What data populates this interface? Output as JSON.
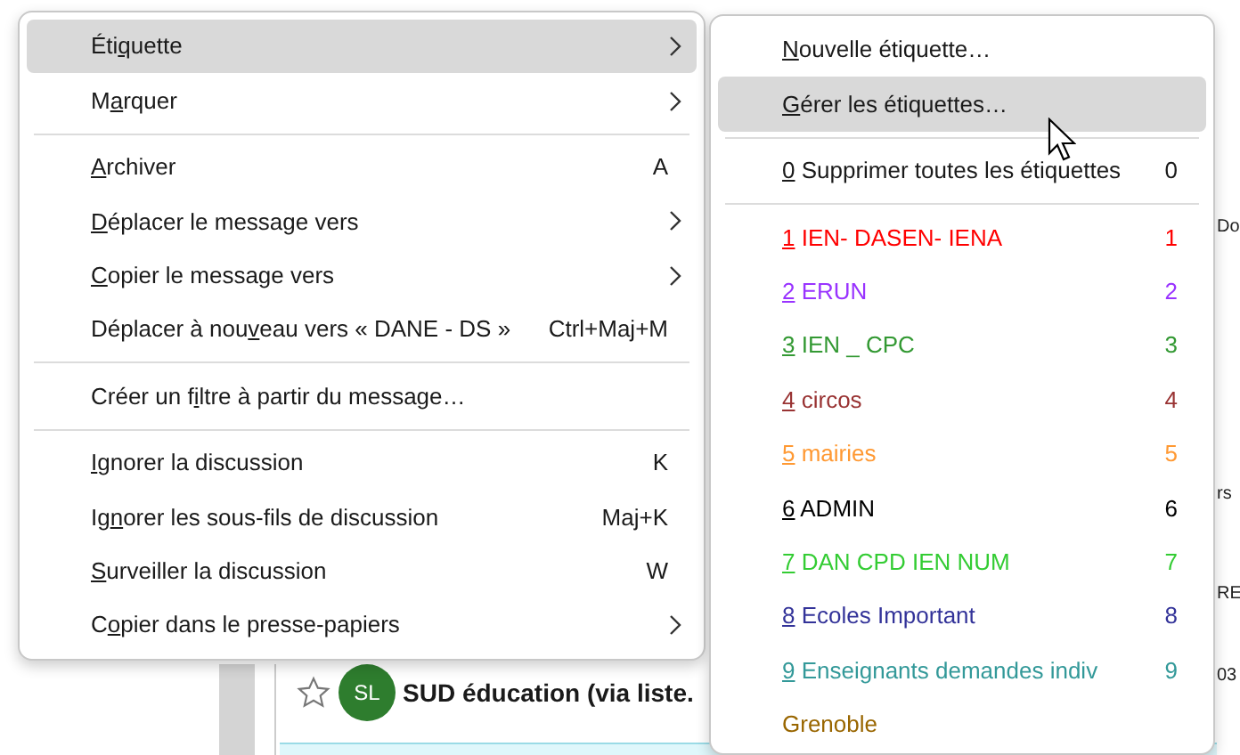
{
  "background": {
    "fragments": [
      "Do",
      "rs",
      "RE",
      "03"
    ],
    "message_row": {
      "starred": false,
      "avatar": "SL",
      "sender": "SUD éducation (via liste."
    }
  },
  "context_menu": {
    "items": [
      {
        "kind": "item",
        "label": {
          "pre": "Éti",
          "key": "q",
          "post": "uette"
        },
        "submenu": true,
        "selected": true
      },
      {
        "kind": "item",
        "label": {
          "pre": "M",
          "key": "a",
          "post": "rquer"
        },
        "submenu": true,
        "selected": false
      },
      {
        "kind": "separator"
      },
      {
        "kind": "item",
        "label": {
          "key": "A",
          "post": "rchiver"
        },
        "shortcut": "A",
        "selected": false
      },
      {
        "kind": "item",
        "label": {
          "key": "D",
          "post": "éplacer le message vers"
        },
        "submenu": true,
        "selected": false
      },
      {
        "kind": "item",
        "label": {
          "key": "C",
          "post": "opier le message vers"
        },
        "submenu": true,
        "selected": false
      },
      {
        "kind": "item",
        "label": {
          "pre": "Déplacer à nou",
          "key": "v",
          "post": "eau vers « DANE - DS »"
        },
        "shortcut": "Ctrl+Maj+M",
        "selected": false
      },
      {
        "kind": "separator"
      },
      {
        "kind": "item",
        "label": {
          "pre": "Créer un f",
          "key": "i",
          "post": "ltre à partir du message…"
        },
        "selected": false
      },
      {
        "kind": "separator"
      },
      {
        "kind": "item",
        "label": {
          "key": "I",
          "post": "gnorer la discussion"
        },
        "shortcut": "K",
        "selected": false
      },
      {
        "kind": "item",
        "label": {
          "pre": "Ig",
          "key": "n",
          "post": "orer les sous-fils de discussion"
        },
        "shortcut": "Maj+K",
        "selected": false
      },
      {
        "kind": "item",
        "label": {
          "key": "S",
          "post": "urveiller la discussion"
        },
        "shortcut": "W",
        "selected": false
      },
      {
        "kind": "item",
        "label": {
          "pre": "C",
          "key": "o",
          "post": "pier dans le presse-papiers"
        },
        "submenu": true,
        "selected": false
      }
    ]
  },
  "tag_submenu": {
    "items": [
      {
        "kind": "item",
        "label": {
          "key": "N",
          "post": "ouvelle étiquette…"
        },
        "selected": false
      },
      {
        "kind": "item",
        "label": {
          "key": "G",
          "post": "érer les étiquettes…"
        },
        "selected": true
      },
      {
        "kind": "separator"
      },
      {
        "kind": "item",
        "label": {
          "key": "0",
          "post": " Supprimer toutes les étiquettes"
        },
        "shortcut": "0",
        "selected": false
      },
      {
        "kind": "separator"
      },
      {
        "kind": "tag",
        "label": {
          "key": "1",
          "post": " IEN- DASEN- IENA"
        },
        "shortcut": "1",
        "color": "#ff0000",
        "selected": false
      },
      {
        "kind": "tag",
        "label": {
          "key": "2",
          "post": " ERUN"
        },
        "shortcut": "2",
        "color": "#9933ff",
        "selected": false
      },
      {
        "kind": "tag",
        "label": {
          "key": "3",
          "post": " IEN _ CPC"
        },
        "shortcut": "3",
        "color": "#339933",
        "selected": false
      },
      {
        "kind": "tag",
        "label": {
          "key": "4",
          "post": " circos"
        },
        "shortcut": "4",
        "color": "#993333",
        "selected": false
      },
      {
        "kind": "tag",
        "label": {
          "key": "5",
          "post": " mairies"
        },
        "shortcut": "5",
        "color": "#ff9933",
        "selected": false
      },
      {
        "kind": "tag",
        "label": {
          "key": "6",
          "post": " ADMIN"
        },
        "shortcut": "6",
        "color": "#000000",
        "selected": false
      },
      {
        "kind": "tag",
        "label": {
          "key": "7",
          "post": " DAN CPD IEN NUM"
        },
        "shortcut": "7",
        "color": "#33cc33",
        "selected": false
      },
      {
        "kind": "tag",
        "label": {
          "key": "8",
          "post": " Ecoles Important"
        },
        "shortcut": "8",
        "color": "#333399",
        "selected": false
      },
      {
        "kind": "tag",
        "label": {
          "key": "9",
          "post": " Enseignants demandes indiv"
        },
        "shortcut": "9",
        "color": "#339999",
        "selected": false
      },
      {
        "kind": "tag",
        "label": {
          "pre": "Grenoble"
        },
        "color": "#996600",
        "selected": false
      }
    ]
  }
}
